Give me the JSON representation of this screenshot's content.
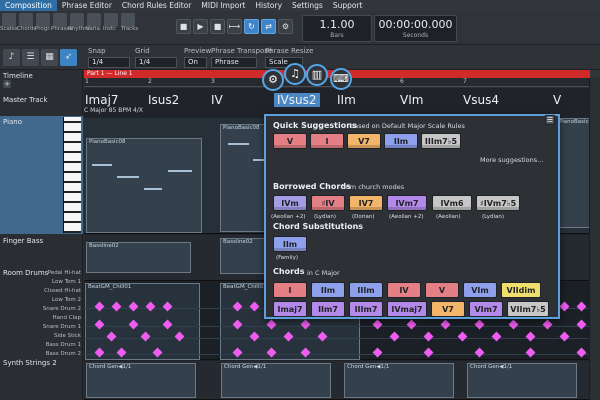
{
  "menu": [
    "Composition",
    "Phrase Editor",
    "Chord Rules Editor",
    "MIDI Import",
    "History",
    "Settings",
    "Support"
  ],
  "top_labels": {
    "mini_icons": [
      "Scales",
      "Chords",
      "Progr.",
      "Phrases",
      "Rhythm",
      "Varia.",
      "Instr.",
      "Tracks"
    ],
    "bars": "1.1.00",
    "bars_unit": "Bars",
    "seconds": "00:00:00.000",
    "seconds_unit": "Seconds"
  },
  "toolbar": {
    "snap_label": "Snap",
    "snap_value": "1/4",
    "grid_label": "Grid",
    "grid_value": "1/4",
    "preview_label": "Preview",
    "preview_value": "On",
    "phrase_transpose_label": "Phrase Transpose",
    "phrase_transpose_value": "Phrase",
    "phrase_resize_label": "Phrase Resize",
    "phrase_resize_value": "Scale"
  },
  "left_panel": {
    "timeline": "Timeline",
    "master_track": "Master Track",
    "piano": "Piano",
    "finger_bass": "Finger Bass",
    "room_drums": "Room Drums",
    "synth_strings": "Synth Strings 2",
    "drum_labels": [
      "Pedal Hi-hat",
      "Low Tom 1",
      "Closed Hi-hat",
      "Low Tom 2",
      "Snare Drum 2",
      "Hand Clap",
      "Snare Drum 1",
      "Side Stick",
      "Bass Drum 1",
      "Bass Drum 2"
    ]
  },
  "arrangement": {
    "section_label": "Part 1 — Line 1",
    "rulers": [
      "1",
      "2",
      "3",
      "4",
      "5",
      "6",
      "7"
    ],
    "chords": [
      "Imaj7",
      "Isus2",
      "IV",
      "IVsus2",
      "IIm",
      "VIm",
      "Vsus4",
      "V"
    ],
    "key_info": "C Major  85 BPM  4/X",
    "piano_clip_1": "PianoBasic08",
    "piano_clip_2": "PianoBasic08",
    "piano_clip_3": "PianoBasic08",
    "bass_clip_1": "Bassline02",
    "bass_clip_2": "Bassline02",
    "drum_clip_1": "BeatGM_Chill01",
    "drum_clip_2": "BeatGM_Chill01",
    "synth_clip": "Chord Gen◀1/1"
  },
  "popup": {
    "quick_suggestions_title": "Quick Suggestions",
    "quick_suggestions_subtitle": "based on  Default Major Scale Rules",
    "quick_chords": [
      "V",
      "I",
      "V7",
      "IIm",
      "IIIm7♭5"
    ],
    "more_suggestions": "More suggestions...",
    "borrowed_chords_title": "Borrowed Chords",
    "borrowed_from": "from  church modes",
    "borrowed_chords": [
      "IVm",
      "♯IV",
      "IV7",
      "IVm7",
      "IVm6",
      "♯IVm7♭5"
    ],
    "borrowed_captions": [
      "(Aeolian +2)",
      "(Lydian)",
      "(Dorian)",
      "(Aeolian +2)",
      "(Aeolian)",
      "(Lydian)"
    ],
    "chord_substitutions_title": "Chord Substitutions",
    "substitutions": [
      "IIm"
    ],
    "substitution_caption": "(Family)",
    "chords_title": "Chords",
    "chords_subtitle": "in  C Major",
    "chords_row1": [
      "I",
      "IIm",
      "IIIm",
      "IV",
      "V",
      "VIm",
      "VIIdim"
    ],
    "chords_row2": [
      "Imaj7",
      "IIm7",
      "IIIm7",
      "IVmaj7",
      "V7",
      "VIm7",
      "VIIm7♭5"
    ]
  },
  "colors": {
    "accent_blue": "#5c9fda",
    "red_section": "#d12a2a",
    "drum_magenta": "#ee5cf0",
    "chord_red": "#e47f86",
    "chord_blue": "#8ea0eb",
    "chord_orange": "#f2b56a",
    "chord_purple": "#b38ae9",
    "chord_gray": "#c7c7c7",
    "chord_yellow": "#f0df6d"
  },
  "icons": [
    "settings-icon",
    "music-icon",
    "piano-icon",
    "keyboard-icon"
  ]
}
